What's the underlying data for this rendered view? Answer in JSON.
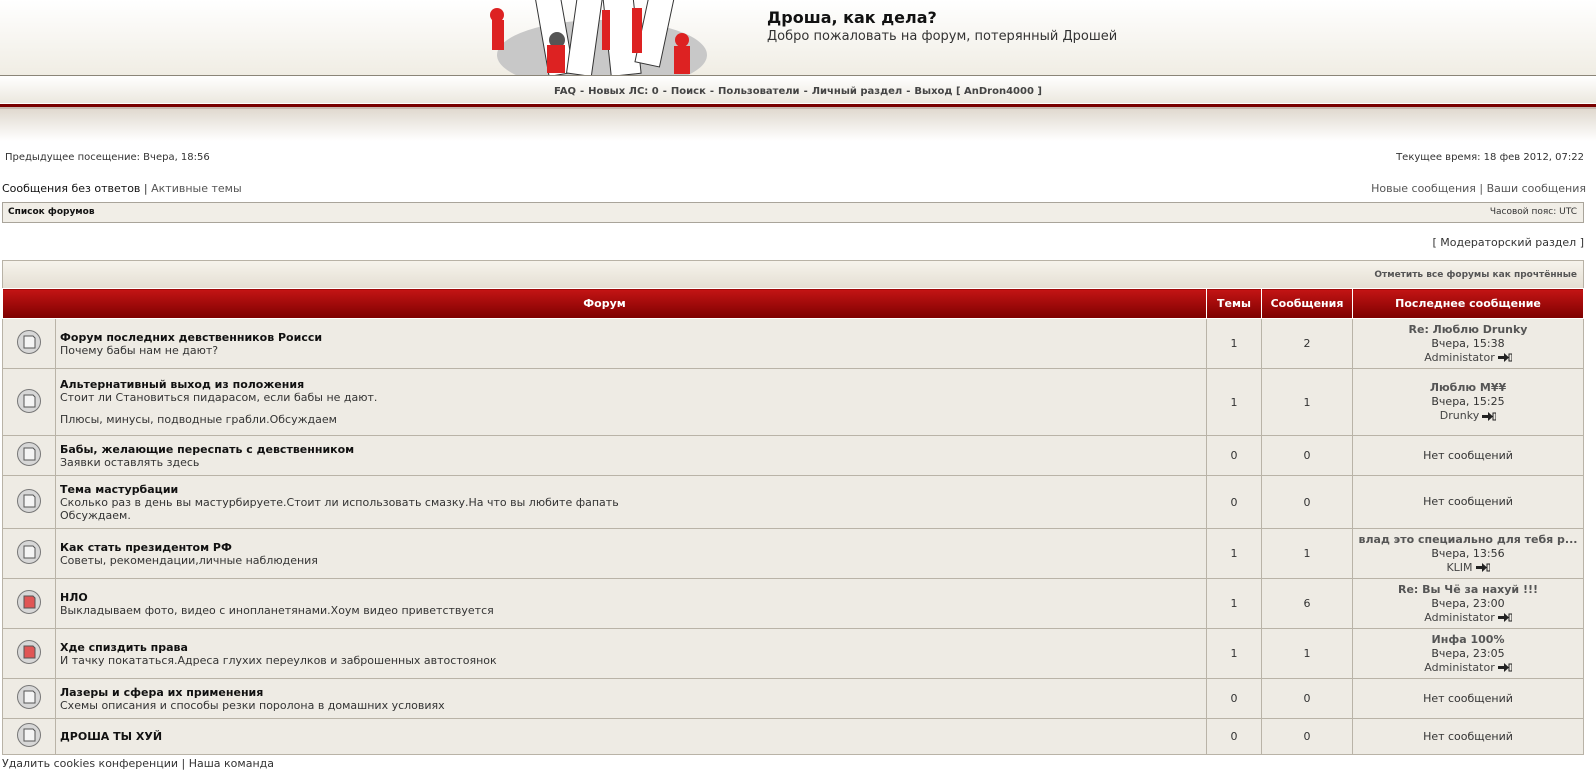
{
  "header": {
    "title": "Дроша, как дела?",
    "description": "Добро пожаловать на форум, потерянный Дрошей"
  },
  "nav": {
    "faq": "FAQ",
    "pm": "Новых ЛС: 0",
    "search": "Поиск",
    "users": "Пользователи",
    "ucp": "Личный раздел",
    "logout": "Выход [ AnDron4000 ]"
  },
  "visit": {
    "last": "Предыдущее посещение: Вчера, 18:56",
    "current": "Текущее время: 18 фев 2012, 07:22"
  },
  "links": {
    "unanswered": "Сообщения без ответов",
    "active": "Активные темы",
    "new_posts": "Новые сообщения",
    "your_posts": "Ваши сообщения"
  },
  "breadcrumb": {
    "index": "Список форумов",
    "timezone": "Часовой пояс: UTC"
  },
  "mod": {
    "label": "Модераторский раздел"
  },
  "mark_read": "Отметить все форумы как прочтённые",
  "table": {
    "headers": {
      "forum": "Форум",
      "topics": "Темы",
      "posts": "Сообщения",
      "last": "Последнее сообщение"
    },
    "rows": [
      {
        "name": "Форум последних девственников Роисси",
        "desc": "Почему бабы нам не дают?",
        "desc2": "",
        "topics": "1",
        "posts": "2",
        "last_title": "Re: Люблю Drunky",
        "last_date": "Вчера, 15:38",
        "last_author": "Administator",
        "unread": false
      },
      {
        "name": "Альтернативный выход из положения",
        "desc": "Стоит ли Становиться пидарасом, если бабы не дают.",
        "desc2": "Плюсы, минусы, подводные грабли.Обсуждаем",
        "topics": "1",
        "posts": "1",
        "last_title": "Люблю M¥¥",
        "last_date": "Вчера, 15:25",
        "last_author": "Drunky",
        "unread": false
      },
      {
        "name": "Бабы, желающие переспать с девственником",
        "desc": "Заявки оставлять здесь",
        "desc2": "",
        "topics": "0",
        "posts": "0",
        "none": "Нет сообщений",
        "unread": false
      },
      {
        "name": "Тема мастурбации",
        "desc": "Сколько раз в день вы мастурбируете.Стоит ли использовать смазку.На что вы любите фапать",
        "desc2": "Обсуждаем.",
        "topics": "0",
        "posts": "0",
        "none": "Нет сообщений",
        "unread": false
      },
      {
        "name": "Как стать президентом РФ",
        "desc": "Советы, рекомендации,личные наблюдения",
        "desc2": "",
        "topics": "1",
        "posts": "1",
        "last_title": "влад это специально для тебя р...",
        "last_date": "Вчера, 13:56",
        "last_author": "KLIM",
        "unread": false
      },
      {
        "name": "НЛО",
        "desc": "Выкладываем фото, видео с инопланетянами.Хоум видео приветствуется",
        "desc2": "",
        "topics": "1",
        "posts": "6",
        "last_title": "Re: Вы Чё за нахуй !!!",
        "last_date": "Вчера, 23:00",
        "last_author": "Administator",
        "unread": true
      },
      {
        "name": "Хде спиздить права",
        "desc": "И тачку покататься.Адреса глухих переулков и заброшенных автостоянок",
        "desc2": "",
        "topics": "1",
        "posts": "1",
        "last_title": "Инфа 100%",
        "last_date": "Вчера, 23:05",
        "last_author": "Administator",
        "unread": true
      },
      {
        "name": "Лазеры и сфера их применения",
        "desc": "Схемы описания и способы резки поролона в домашних условиях",
        "desc2": "",
        "topics": "0",
        "posts": "0",
        "none": "Нет сообщений",
        "unread": false
      },
      {
        "name": "ДРОША ТЫ ХУЙ",
        "desc": "",
        "desc2": "",
        "topics": "0",
        "posts": "0",
        "none": "Нет сообщений",
        "unread": false
      }
    ]
  },
  "footer": {
    "cookies": "Удалить cookies конференции",
    "team": "Наша команда"
  },
  "colors": {
    "accent_red": "#a00000",
    "row_bg": "#eeebe4",
    "border": "#b9b3a7"
  }
}
